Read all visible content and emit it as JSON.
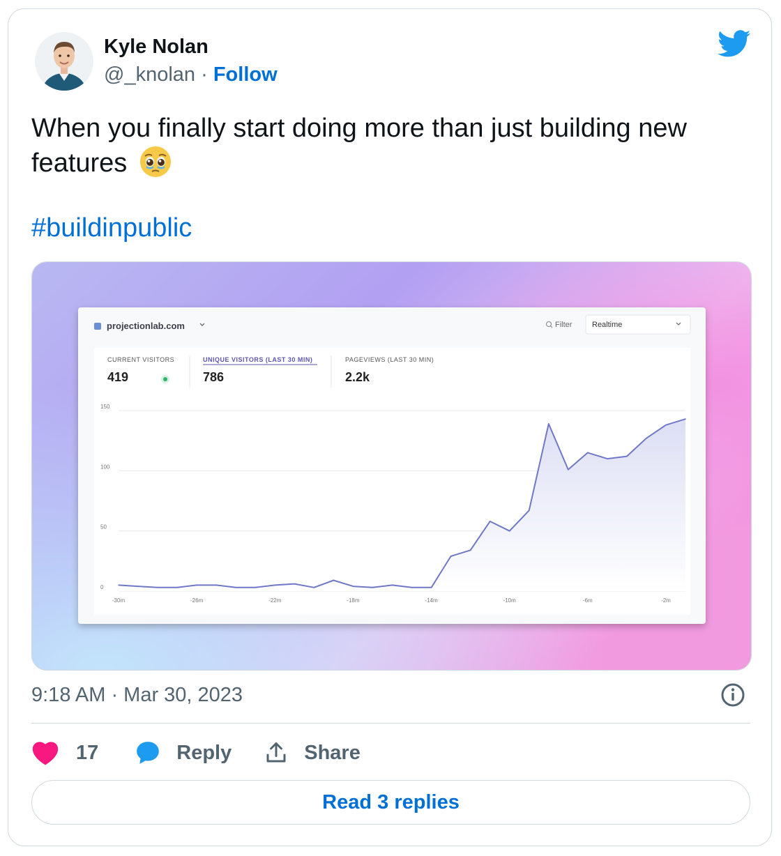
{
  "author": {
    "name": "Kyle Nolan",
    "handle": "@_knolan",
    "separator": "·",
    "follow_label": "Follow"
  },
  "tweet": {
    "text": "When you finally start doing more than just building new features",
    "emoji": "pleading-face-with-tears-emoji",
    "hashtag": "#buildinpublic",
    "timestamp": "9:18 AM · Mar 30, 2023"
  },
  "dashboard": {
    "site": "projectionlab.com",
    "filter_label": "Filter",
    "period_select": "Realtime",
    "stats": [
      {
        "label": "CURRENT VISITORS",
        "value": "419"
      },
      {
        "label": "UNIQUE VISITORS (LAST 30 MIN)",
        "value": "786"
      },
      {
        "label": "PAGEVIEWS (LAST 30 MIN)",
        "value": "2.2k"
      }
    ]
  },
  "chart_data": {
    "type": "area",
    "x": [
      -30,
      -29,
      -28,
      -27,
      -26,
      -25,
      -24,
      -23,
      -22,
      -21,
      -20,
      -19,
      -18,
      -17,
      -16,
      -15,
      -14,
      -13,
      -12,
      -11,
      -10,
      -9,
      -8,
      -7,
      -6,
      -5,
      -4,
      -3,
      -2,
      -1
    ],
    "values": [
      5,
      4,
      3,
      3,
      5,
      5,
      3,
      3,
      5,
      6,
      3,
      9,
      4,
      3,
      5,
      3,
      3,
      29,
      34,
      58,
      50,
      67,
      139,
      101,
      115,
      110,
      112,
      127,
      138,
      143
    ],
    "x_tick_labels": [
      "-30m",
      "-26m",
      "-22m",
      "-18m",
      "-14m",
      "-10m",
      "-6m",
      "-2m"
    ],
    "x_tick_values": [
      -30,
      -26,
      -22,
      -18,
      -14,
      -10,
      -6,
      -2
    ],
    "y_ticks": [
      0,
      50,
      100,
      150
    ],
    "ylim": [
      0,
      150
    ],
    "grid": true,
    "line_color": "#6f78c7",
    "fill_color": "#e6e8f7"
  },
  "engagement": {
    "likes": "17",
    "reply_label": "Reply",
    "share_label": "Share",
    "read_replies_label": "Read 3 replies"
  },
  "colors": {
    "link": "#006fd6",
    "like": "#f91880",
    "reply_bubble": "#1d9bf0",
    "twitter_blue": "#1d9bf0",
    "muted": "#536471"
  },
  "icons": {
    "brand": "twitter-bird-icon",
    "info": "info-circle-icon",
    "like": "heart-icon",
    "reply": "speech-bubble-icon",
    "share": "share-upload-icon"
  }
}
